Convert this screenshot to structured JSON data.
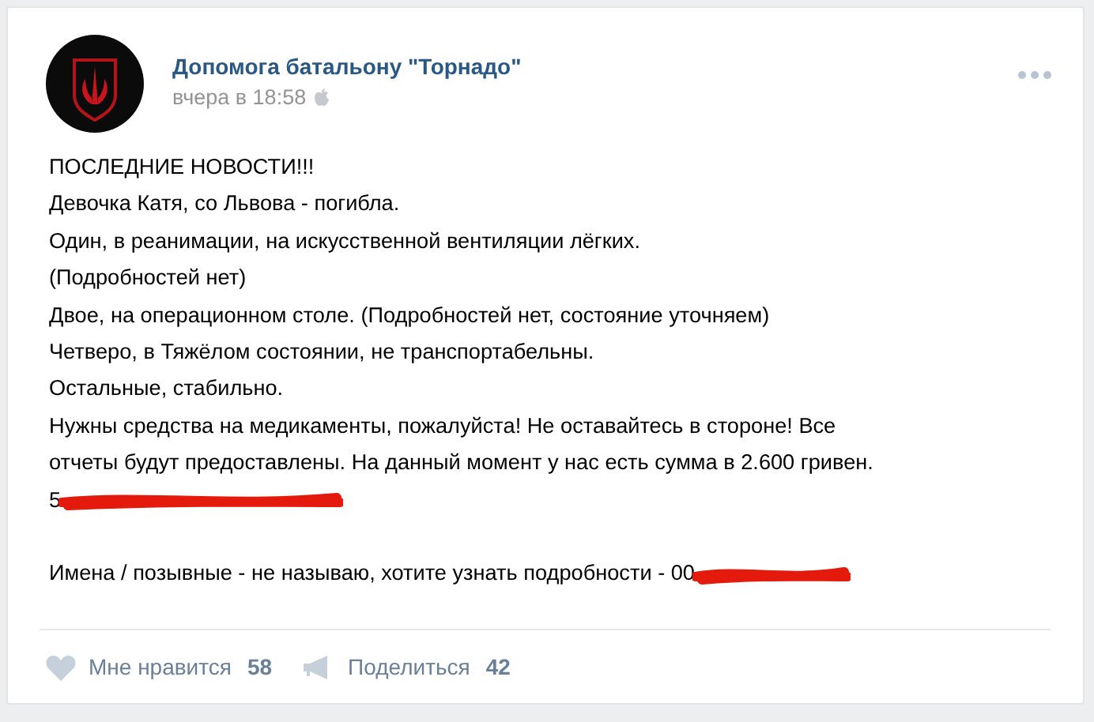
{
  "post": {
    "author": "Допомога батальону \"Торнадо\"",
    "time": "вчера в 18:58",
    "paragraphs": [
      {
        "lines": [
          {
            "text": "ПОСЛЕДНИЕ НОВОСТИ!!!"
          },
          {
            "text": "Девочка Катя, со Львова - погибла."
          },
          {
            "text": "Один, в реанимации, на искусственной вентиляции лёгких."
          },
          {
            "text": "(Подробностей нет)"
          },
          {
            "text": "Двое, на операционном столе. (Подробностей нет, состояние уточняем)"
          },
          {
            "text": "Четверо, в Тяжёлом состоянии, не транспортабельны."
          },
          {
            "text": "Остальные, стабильно."
          },
          {
            "text": "Нужны средства на медикаменты, пожалуйста! Не оставайтесь в стороне! Все"
          },
          {
            "text": "отчеты будут предоставлены. На данный момент у нас есть сумма в 2.600 гривен."
          },
          {
            "text": "5",
            "redacted": true
          }
        ]
      },
      {
        "lines": [
          {
            "text": "Имена / позывные - не называю, хотите узнать подробности - 00",
            "redacted": true
          }
        ]
      }
    ],
    "likes": {
      "label": "Мне нравится",
      "count": "58"
    },
    "shares": {
      "label": "Поделиться",
      "count": "42"
    }
  }
}
